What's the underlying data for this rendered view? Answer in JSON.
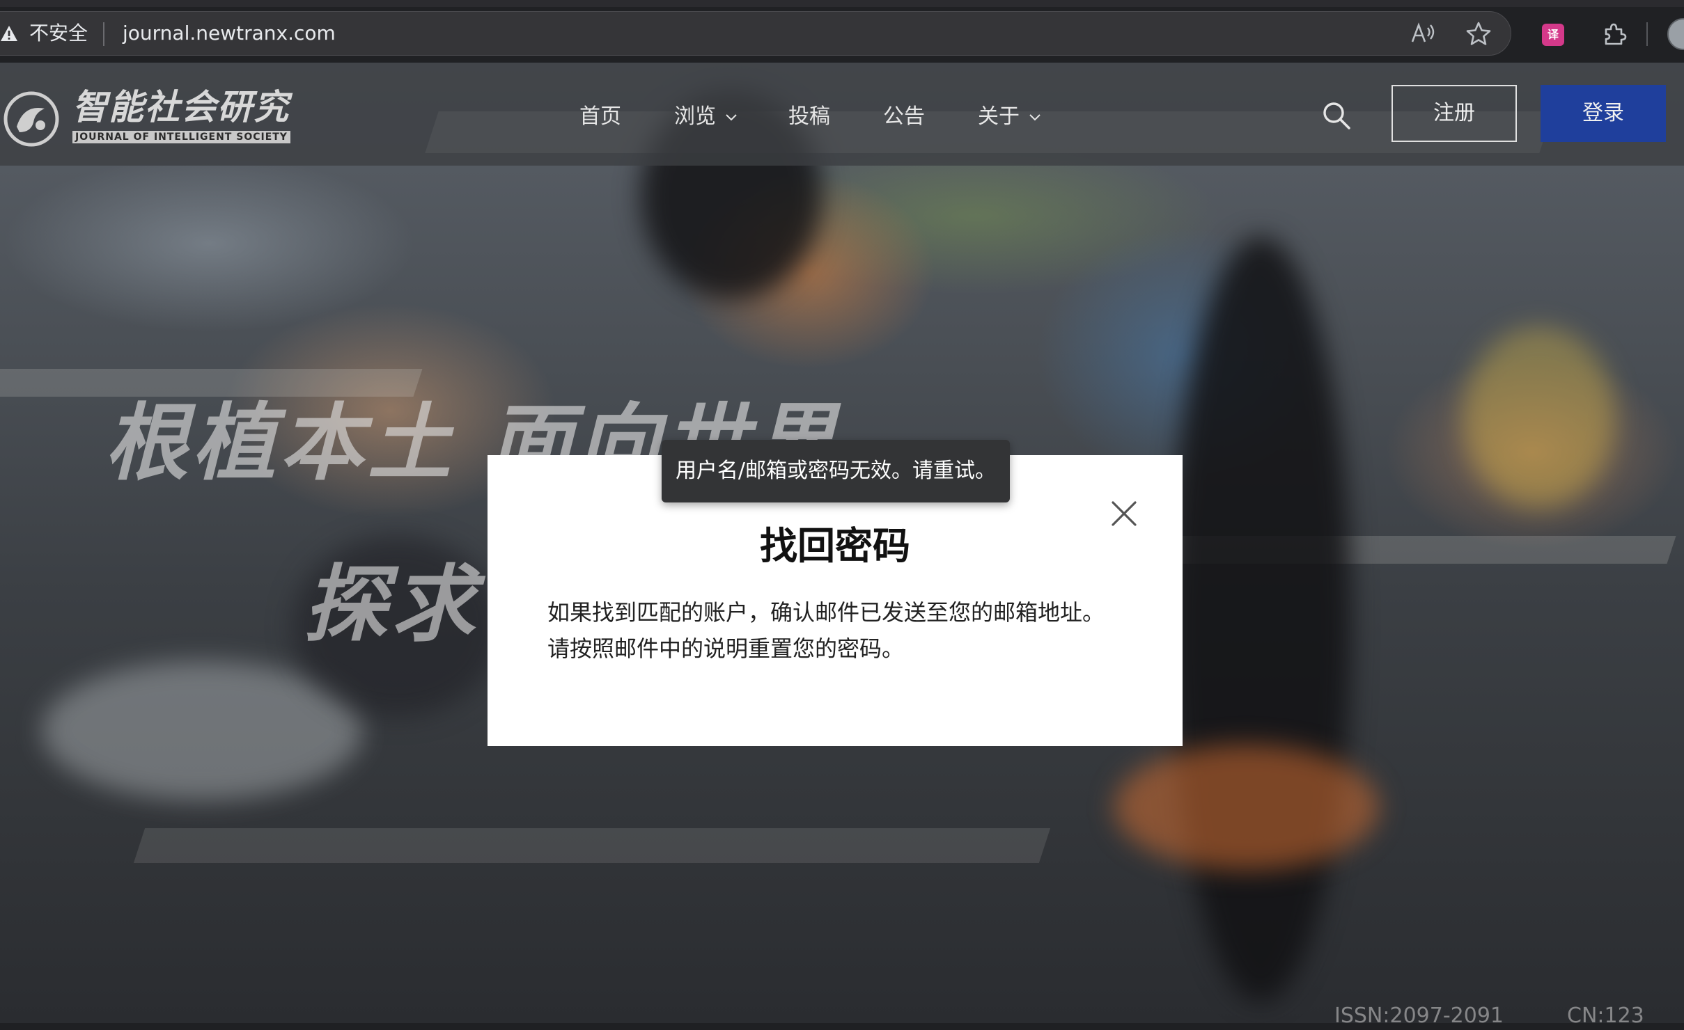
{
  "browser": {
    "security_label": "不安全",
    "url": "journal.newtranx.com",
    "icons": [
      "warning-icon",
      "read-aloud-icon",
      "favorite-star-icon",
      "translate-extension-icon",
      "extensions-puzzle-icon",
      "profile-avatar"
    ]
  },
  "site": {
    "logo_title": "智能社会研究",
    "logo_subtitle": "JOURNAL OF INTELLIGENT SOCIETY",
    "nav": {
      "home": "首页",
      "browse": "浏览",
      "submit": "投稿",
      "notice": "公告",
      "about": "关于"
    },
    "register_label": "注册",
    "login_label": "登录"
  },
  "hero": {
    "slogan_line1": "根植本土  面向世界",
    "slogan_line2": "探求",
    "issn": "ISSN:2097-2091",
    "cn": "CN:123"
  },
  "modal": {
    "title": "找回密码",
    "message_line1": "如果找到匹配的账户，确认邮件已发送至您的邮箱地址。",
    "message_line2": "请按照邮件中的说明重置您的密码。"
  },
  "toast": {
    "message": "用户名/邮箱或密码无效。请重试。"
  },
  "colors": {
    "login_button": "#1f3f9c",
    "header_overlay": "#3c3e42",
    "toast_bg": "#333436"
  }
}
